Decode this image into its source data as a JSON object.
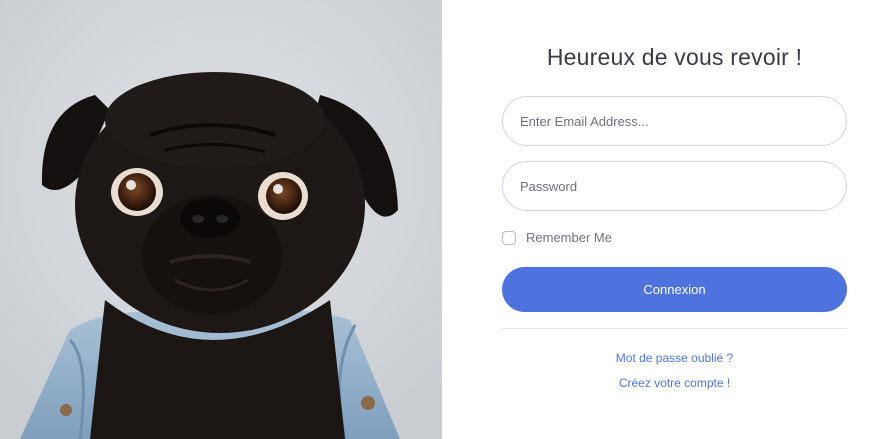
{
  "login": {
    "title": "Heureux de vous revoir !",
    "email_placeholder": "Enter Email Address...",
    "password_placeholder": "Password",
    "remember_label": "Remember Me",
    "remember_checked": false,
    "submit_label": "Connexion",
    "forgot_link": "Mot de passe oublié ?",
    "create_link": "Créez votre compte !"
  },
  "colors": {
    "accent": "#4e73df",
    "text": "#3a3b45",
    "muted": "#6e707e",
    "border": "#d1d3e2"
  },
  "image": {
    "subject": "pug-dog-photo"
  }
}
